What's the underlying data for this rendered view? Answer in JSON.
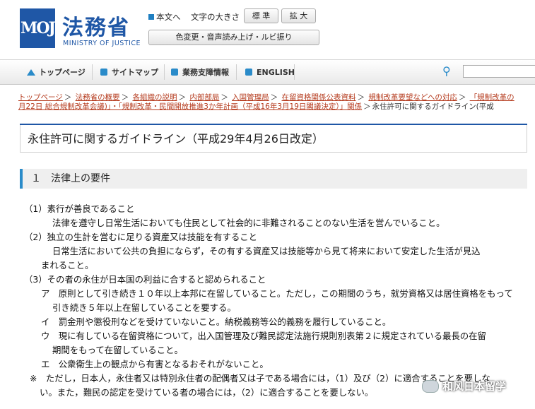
{
  "header": {
    "logo_mark": "MOJ",
    "title": "法務省",
    "subtitle": "MINISTRY OF JUSTICE",
    "skip_link": "本文へ",
    "font_size_label": "文字の大きさ",
    "btn_standard": "標 準",
    "btn_large": "拡 大",
    "btn_color": "色変更・音声読み上げ・ルビ振り"
  },
  "nav": {
    "items": [
      {
        "label": "トップページ",
        "icon": "house-icon"
      },
      {
        "label": "サイトマップ",
        "icon": "square-icon"
      },
      {
        "label": "業務支障情報",
        "icon": "square-icon"
      },
      {
        "label": "ENGLISH",
        "icon": "square-icon"
      }
    ],
    "search_icon": "key-icon"
  },
  "breadcrumb": {
    "line1": [
      "トップページ",
      "法務省の概要",
      "各組織の説明",
      "内部部局",
      "入国管理局",
      "在留資格関係公表資料",
      "規制改革要望などへの対応",
      "「規制改革の"
    ],
    "line2_link": "月22日 総合規制改革会議)」・「規制改革・民間開放推進3か年計画（平成16年3月19日閣議決定）」関係",
    "line2_current": "永住許可に関するガイドライン(平成"
  },
  "page_title": "永住許可に関するガイドライン（平成29年4月26日改定）",
  "section_title": "１　法律上の要件",
  "body": {
    "l1": "（1）素行が善良であること",
    "l2": "法律を遵守し日常生活においても住民として社会的に非難されることのない生活を営んでいること。",
    "l3": "（2）独立の生計を営むに足りる資産又は技能を有すること",
    "l4": "日常生活において公共の負担にならず，その有する資産又は技能等から見て将来において安定した生活が見込",
    "l5": "まれること。",
    "l6": "（3）その者の永住が日本国の利益に合すると認められること",
    "l7": "ア　原則として引き続き１０年以上本邦に在留していること。ただし，この期間のうち，就労資格又は居住資格をもって",
    "l8": "引き続き５年以上在留していることを要する。",
    "l9": "イ　罰金刑や懲役刑などを受けていないこと。納税義務等公的義務を履行していること。",
    "l10": "ウ　現に有している在留資格について，出入国管理及び難民認定法施行規則別表第２に規定されている最長の在留",
    "l11": "期間をもって在留していること。",
    "l12": "エ　公衆衛生上の観点から有害となるおそれがないこと。",
    "l13": "※　ただし，日本人，永住者又は特別永住者の配偶者又は子である場合には，（1）及び（2）に適合することを要しな",
    "l14": "い。また，難民の認定を受けている者の場合には，（2）に適合することを要しない。"
  },
  "watermark": "和风日本留学",
  "colors": {
    "brand": "#1f57a6",
    "link": "#b53b1e",
    "accent": "#2a8bc9"
  }
}
